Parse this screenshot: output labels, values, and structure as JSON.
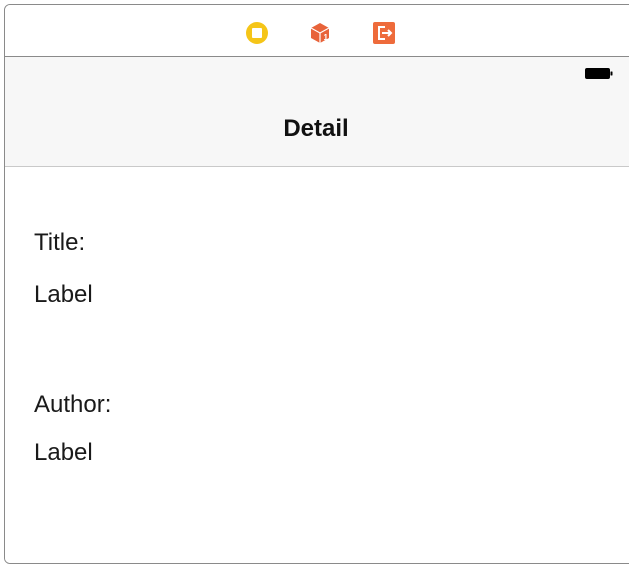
{
  "scene_dock": {
    "icons": [
      "view-controller-icon",
      "first-responder-icon",
      "exit-icon"
    ]
  },
  "status_bar": {
    "battery_icon": "battery-icon"
  },
  "nav_bar": {
    "title": "Detail"
  },
  "content": {
    "title_label": "Title:",
    "title_value": "Label",
    "author_label": "Author:",
    "author_value": "Label"
  },
  "colors": {
    "view_controller": "#f5c518",
    "first_responder": "#e8633a",
    "exit": "#ee6b3b"
  }
}
